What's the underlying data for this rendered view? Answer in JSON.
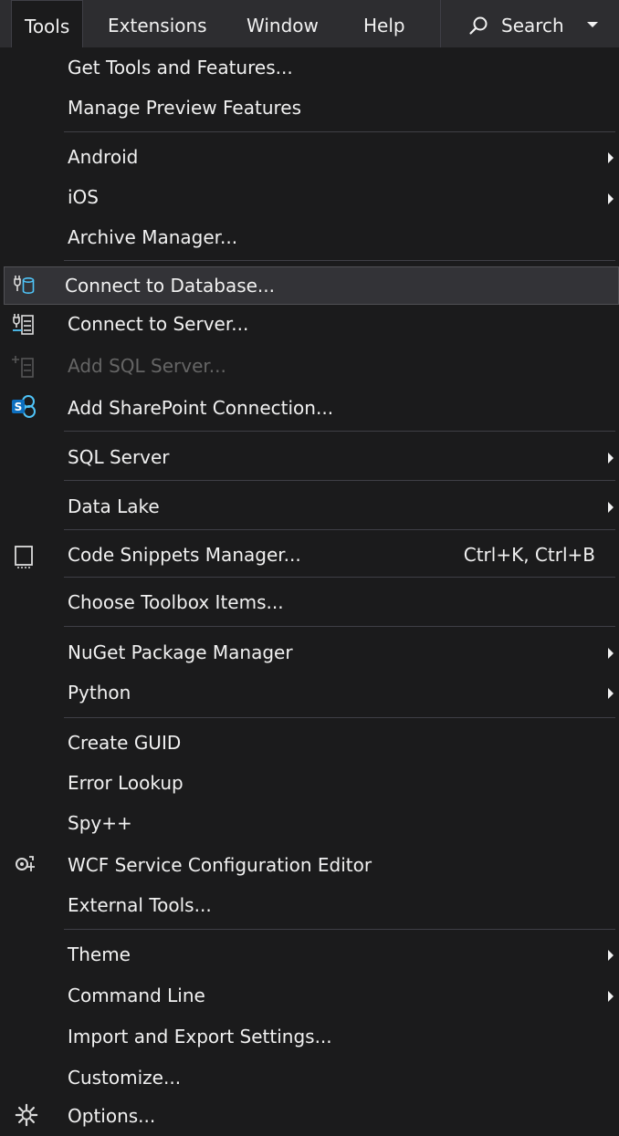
{
  "menubar": {
    "items": [
      {
        "label": "Tools",
        "active": true
      },
      {
        "label": "Extensions"
      },
      {
        "label": "Window"
      },
      {
        "label": "Help"
      }
    ],
    "search": {
      "label": "Search",
      "icon": "search-icon"
    }
  },
  "menu": {
    "items": [
      {
        "label": "Get Tools and Features..."
      },
      {
        "label": "Manage Preview Features"
      },
      {
        "label": "Android",
        "submenu": true
      },
      {
        "label": "iOS",
        "submenu": true
      },
      {
        "label": "Archive Manager..."
      },
      {
        "label": "Connect to Database...",
        "icon": "database-plug-icon",
        "highlighted": true
      },
      {
        "label": "Connect to Server...",
        "icon": "server-plug-icon"
      },
      {
        "label": "Add SQL Server...",
        "icon": "add-sql-server-icon",
        "disabled": true
      },
      {
        "label": "Add SharePoint Connection...",
        "icon": "sharepoint-icon"
      },
      {
        "label": "SQL Server",
        "submenu": true
      },
      {
        "label": "Data Lake",
        "submenu": true
      },
      {
        "label": "Code Snippets Manager...",
        "icon": "code-snippets-icon",
        "shortcut": "Ctrl+K, Ctrl+B"
      },
      {
        "label": "Choose Toolbox Items..."
      },
      {
        "label": "NuGet Package Manager",
        "submenu": true
      },
      {
        "label": "Python",
        "submenu": true
      },
      {
        "label": "Create GUID"
      },
      {
        "label": "Error Lookup"
      },
      {
        "label": "Spy++"
      },
      {
        "label": "WCF Service Configuration Editor",
        "icon": "wcf-config-icon"
      },
      {
        "label": "External Tools..."
      },
      {
        "label": "Theme",
        "submenu": true
      },
      {
        "label": "Command Line",
        "submenu": true
      },
      {
        "label": "Import and Export Settings..."
      },
      {
        "label": "Customize..."
      },
      {
        "label": "Options...",
        "icon": "gear-icon"
      }
    ]
  },
  "colors": {
    "menu_bg": "#1b1b1c",
    "menubar_bg": "#2d2d30",
    "text": "#f1f1f1",
    "disabled_text": "#656565",
    "highlight_bg": "#333337",
    "separator": "#3f3f46",
    "icon_accent": "#4fc3f7",
    "sharepoint_blue": "#0d6fbf"
  }
}
